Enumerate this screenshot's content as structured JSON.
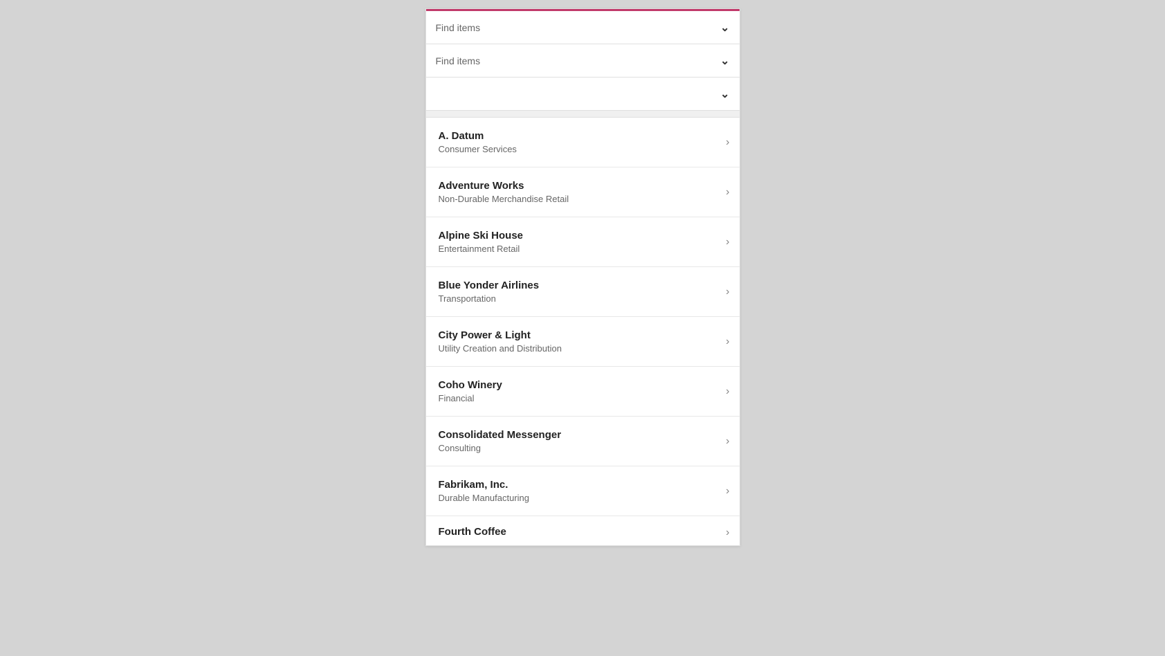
{
  "topbar": {
    "color": "#c1396a"
  },
  "filters": [
    {
      "id": "filter1",
      "placeholder": "Find items",
      "has_text": true
    },
    {
      "id": "filter2",
      "placeholder": "Find items",
      "has_text": true
    },
    {
      "id": "filter3",
      "placeholder": "",
      "has_text": false
    }
  ],
  "chevron_down": "⌄",
  "chevron_right": ">",
  "items": [
    {
      "id": "a-datum",
      "name": "A. Datum",
      "category": "Consumer Services"
    },
    {
      "id": "adventure-works",
      "name": "Adventure Works",
      "category": "Non-Durable Merchandise Retail"
    },
    {
      "id": "alpine-ski-house",
      "name": "Alpine Ski House",
      "category": "Entertainment Retail"
    },
    {
      "id": "blue-yonder-airlines",
      "name": "Blue Yonder Airlines",
      "category": "Transportation"
    },
    {
      "id": "city-power-light",
      "name": "City Power & Light",
      "category": "Utility Creation and Distribution"
    },
    {
      "id": "coho-winery",
      "name": "Coho Winery",
      "category": "Financial"
    },
    {
      "id": "consolidated-messenger",
      "name": "Consolidated Messenger",
      "category": "Consulting"
    },
    {
      "id": "fabrikam-inc",
      "name": "Fabrikam, Inc.",
      "category": "Durable Manufacturing"
    },
    {
      "id": "fourth-coffee",
      "name": "Fourth Coffee",
      "category": ""
    }
  ]
}
